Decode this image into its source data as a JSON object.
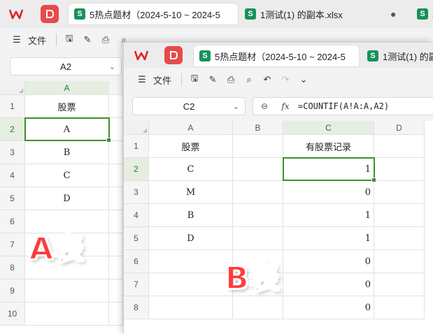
{
  "colors": {
    "accent_green": "#3f8f2d",
    "overlay_red": "#ff3b3b",
    "tab_s_icon": "#17925a"
  },
  "winA": {
    "tabs": [
      {
        "label": "5热点题材（2024-5-10 ~ 2024-5",
        "active": true
      },
      {
        "label": "1测试(1) 的副本.xlsx",
        "active": false
      },
      {
        "label": "2",
        "active": false
      }
    ],
    "toolbar": {
      "menu_label": "文件"
    },
    "namebox": "A2",
    "columns": [
      "A"
    ],
    "rows": [
      "1",
      "2",
      "3",
      "4",
      "5",
      "6",
      "7",
      "8",
      "9",
      "10"
    ],
    "cells": [
      "股票",
      "A",
      "B",
      "C",
      "D",
      "",
      "",
      "",
      "",
      ""
    ]
  },
  "winB": {
    "tabs": [
      {
        "label": "5热点题材（2024-5-10 ~ 2024-5",
        "active": true
      },
      {
        "label": "1测试(1) 的副",
        "active": false
      }
    ],
    "toolbar": {
      "menu_label": "文件"
    },
    "namebox": "C2",
    "fx_label": "fx",
    "formula": "=COUNTIF(A!A:A,A2)",
    "columns": [
      "A",
      "B",
      "C",
      "D"
    ],
    "rows": [
      "1",
      "2",
      "3",
      "4",
      "5",
      "6",
      "7",
      "8"
    ],
    "colA": [
      "股票",
      "C",
      "M",
      "B",
      "D",
      "",
      "",
      ""
    ],
    "colC": [
      "有股票记录",
      "1",
      "0",
      "1",
      "1",
      "0",
      "0",
      "0"
    ]
  },
  "overlays": {
    "a_label": "A表",
    "b_label": "B表"
  }
}
